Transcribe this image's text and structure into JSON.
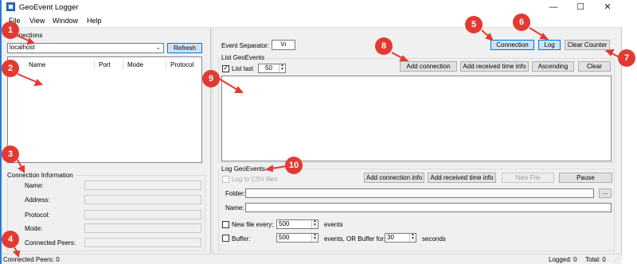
{
  "window": {
    "title": "GeoEvent Logger",
    "controls": {
      "minimize": "—",
      "maximize": "☐",
      "close": "✕"
    }
  },
  "menu": [
    "File",
    "View",
    "Window",
    "Help"
  ],
  "left": {
    "connections_label": "Connections",
    "server_value": "localhost",
    "refresh_label": "Refresh",
    "columns": [
      "Name",
      "Port",
      "Mode",
      "Protocol"
    ],
    "info_label": "Connection Information",
    "info_fields": [
      "Name:",
      "Address:",
      "Protocol:",
      "Mode:",
      "Connected Peers:"
    ]
  },
  "right": {
    "event_separator_label": "Event Separator:",
    "event_separator_value": "\\n",
    "connection_button": "Connection",
    "log_button": "Log",
    "clear_counter_button": "Clear Counter",
    "list_group_label": "List GeoEvents",
    "list_last_label": "List last",
    "list_last_checked": true,
    "list_last_value": "50",
    "add_connection_button": "Add connection",
    "add_received_time_button": "Add received time info",
    "ascending_button": "Ascending",
    "clear_button": "Clear",
    "log_group_label": "Log GeoEvents",
    "log_csv_label": "Log to CSV files",
    "add_connection_info_button": "Add connection info",
    "add_received_time_info_button": "Add received time info",
    "new_file_button": "New File",
    "pause_button": "Pause",
    "folder_label": "Folder:",
    "browse_button": "...",
    "name_label": "Name:",
    "new_file_every_label": "New file every:",
    "new_file_every_value": "500",
    "events_label": "events",
    "buffer_label": "Buffer:",
    "buffer_value": "500",
    "buffer_for_label": "events, OR Buffer for:",
    "buffer_for_value": "30",
    "seconds_label": "seconds"
  },
  "status": {
    "connected_peers": "Connected Peers: 0",
    "logged": "Logged: 0",
    "total": "Total: 0"
  },
  "callouts": [
    "1",
    "2",
    "3",
    "4",
    "5",
    "6",
    "7",
    "8",
    "9",
    "10"
  ],
  "colors": {
    "callout": "#e23a32",
    "window_border": "#2b79d6",
    "selected_button": "#cce4f7"
  }
}
